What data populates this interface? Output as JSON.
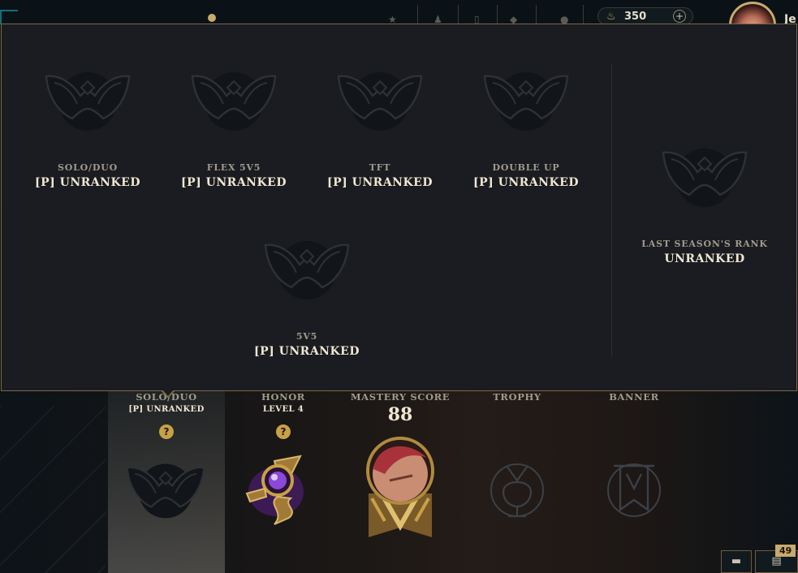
{
  "topbar": {
    "currency_value": "350",
    "currency_add": "+",
    "summoner_name_partial": "Je"
  },
  "popup": {
    "queues": [
      {
        "label": "SOLO/DUO",
        "rank": "[P] UNRANKED"
      },
      {
        "label": "FLEX 5V5",
        "rank": "[P] UNRANKED"
      },
      {
        "label": "TFT",
        "rank": "[P] UNRANKED"
      },
      {
        "label": "DOUBLE UP",
        "rank": "[P] UNRANKED"
      },
      {
        "label": "5V5",
        "rank": "[P] UNRANKED"
      }
    ],
    "last_season": {
      "label": "LAST SEASON'S RANK",
      "rank": "UNRANKED"
    }
  },
  "profile": {
    "solo": {
      "title": "SOLO/DUO",
      "sub": "[P] UNRANKED",
      "help": "?"
    },
    "honor": {
      "title": "HONOR",
      "sub": "LEVEL 4",
      "help": "?"
    },
    "mastery": {
      "title": "MASTERY SCORE",
      "score": "88"
    },
    "trophy": {
      "title": "TROPHY"
    },
    "banner": {
      "title": "BANNER"
    }
  },
  "corner": {
    "badge": "49"
  },
  "colors": {
    "gold": "#c8aa6e",
    "panel": "#1a1c21",
    "text": "#f0e6d2",
    "muted": "#a09b8c"
  }
}
